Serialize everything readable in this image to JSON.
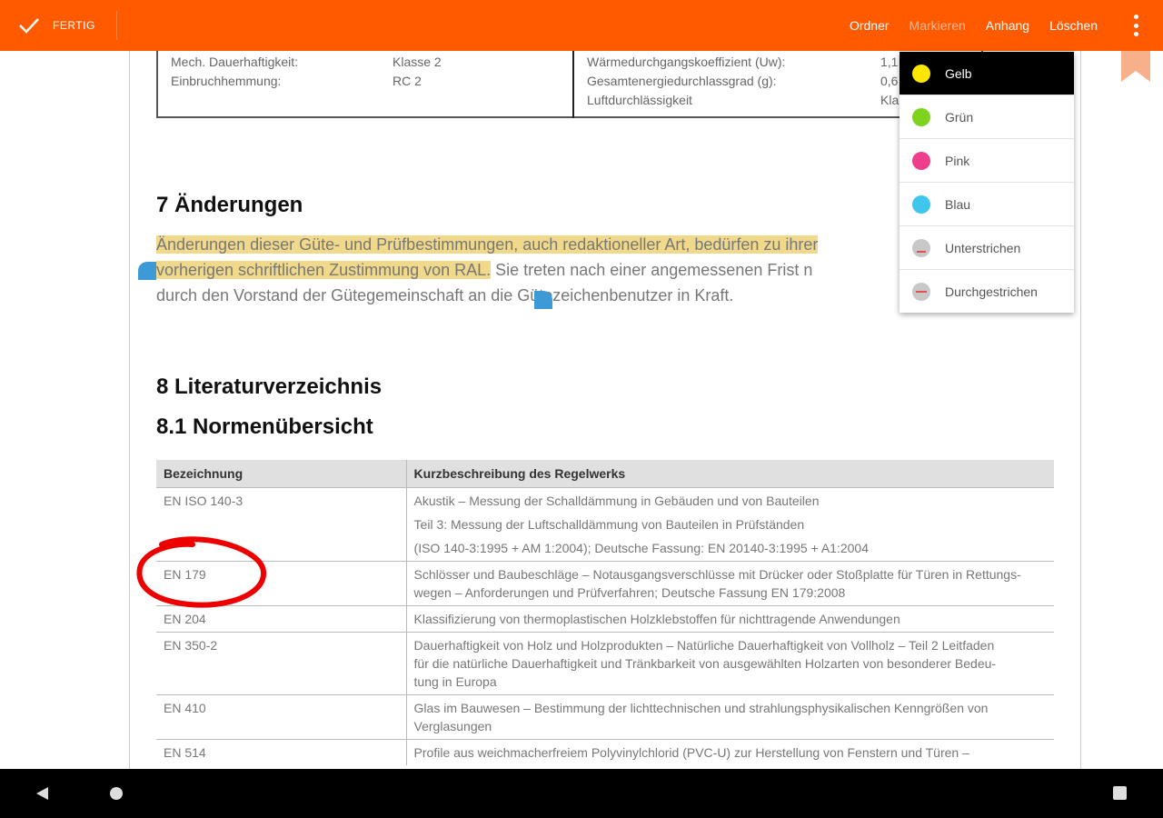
{
  "topbar": {
    "done_label": "FERTIG",
    "actions": [
      "Ordner",
      "Markieren",
      "Anhang",
      "Löschen"
    ],
    "bg_color": "#ff5a00"
  },
  "spec_table": {
    "left_rows": [
      {
        "label": "Mech. Dauerhaftigkeit:",
        "value": "Klasse 2"
      },
      {
        "label": "Einbruchhemmung:",
        "value": "RC 2"
      }
    ],
    "right_rows": [
      {
        "label": "Wärmedurchgangskoeffizient (Uw):",
        "value": "1,1"
      },
      {
        "label": "Gesamtenergiedurchlassgrad (g):",
        "value": "0,6"
      },
      {
        "label": "Luftdurchlässigkeit",
        "value": "Kla"
      }
    ]
  },
  "section7": {
    "heading": "7  Änderungen",
    "line1_highlighted": "Änderungen dieser Güte- und Prüfbestimmungen, auch redaktioneller Art, bedürfen zu ihrer",
    "line2_highlighted": "vorherigen schriftlichen Zustimmung von RAL.",
    "line2_rest": " Sie treten nach einer angemessenen Frist n",
    "line3": "durch den Vorstand der Gütegemeinschaft an die Gütezeichenbenutzer in Kraft."
  },
  "section8": {
    "heading": "8  Literaturverzeichnis",
    "subheading": "8.1  Normenübersicht"
  },
  "norms_table": {
    "headers": [
      "Bezeichnung",
      "Kurzbeschreibung des Regelwerks"
    ],
    "rows": [
      {
        "code": "EN ISO 140-3",
        "lines": [
          "Akustik – Messung der Schalldämmung in Gebäuden und von Bauteilen",
          "Teil 3: Messung der Luftschalldämmung von Bauteilen in Prüfständen",
          "(ISO 140-3:1995 + AM 1:2004); Deutsche Fassung: EN 20140-3:1995 + A1:2004"
        ]
      },
      {
        "code": "EN 179",
        "lines": [
          "Schlösser und Baubeschläge – Notausgangsverschlüsse mit Drücker oder Stoßplatte für Türen in Rettungs-",
          "wegen – Anforderungen und Prüfverfahren; Deutsche Fassung EN 179:2008"
        ]
      },
      {
        "code": "EN 204",
        "lines": [
          "Klassifizierung von thermoplastischen Holzklebstoffen für nichttragende Anwendungen"
        ]
      },
      {
        "code": "EN 350-2",
        "lines": [
          "Dauerhaftigkeit von Holz und Holzprodukten – Natürliche Dauerhaftigkeit von Vollholz – Teil 2 Leitfaden",
          "für die natürliche Dauerhaftigkeit und Tränkbarkeit von ausgewählten Holzarten von besonderer Bedeu-",
          "tung in Europa"
        ]
      },
      {
        "code": "EN 410",
        "lines": [
          "Glas im Bauwesen – Bestimmung der lichttechnischen und strahlungsphysikalischen Kenngrößen von",
          "Verglasungen"
        ]
      },
      {
        "code": "EN 514",
        "lines": [
          "Profile aus weichmacherfreiem Polyvinylchlorid (PVC-U) zur Herstellung von Fenstern und Türen –"
        ]
      }
    ]
  },
  "highlight_menu": {
    "items": [
      {
        "label": "Gelb",
        "color": "#ffe600",
        "kind": "dot",
        "selected": true
      },
      {
        "label": "Grün",
        "color": "#7ed321",
        "kind": "dot",
        "selected": false
      },
      {
        "label": "Pink",
        "color": "#ef3e8c",
        "kind": "dot",
        "selected": false
      },
      {
        "label": "Blau",
        "color": "#3ec6ec",
        "kind": "dot",
        "selected": false
      },
      {
        "label": "Unterstrichen",
        "color": "#e05050",
        "kind": "underline",
        "selected": false
      },
      {
        "label": "Durchgestrichen",
        "color": "#e05050",
        "kind": "strike",
        "selected": false
      }
    ]
  },
  "colors": {
    "accent": "#ff5a00",
    "highlight": "#f1d98b",
    "selection_handle": "#3d9ad6",
    "annotation_circle": "#ee0000",
    "bookmark": "#f7b08a"
  }
}
